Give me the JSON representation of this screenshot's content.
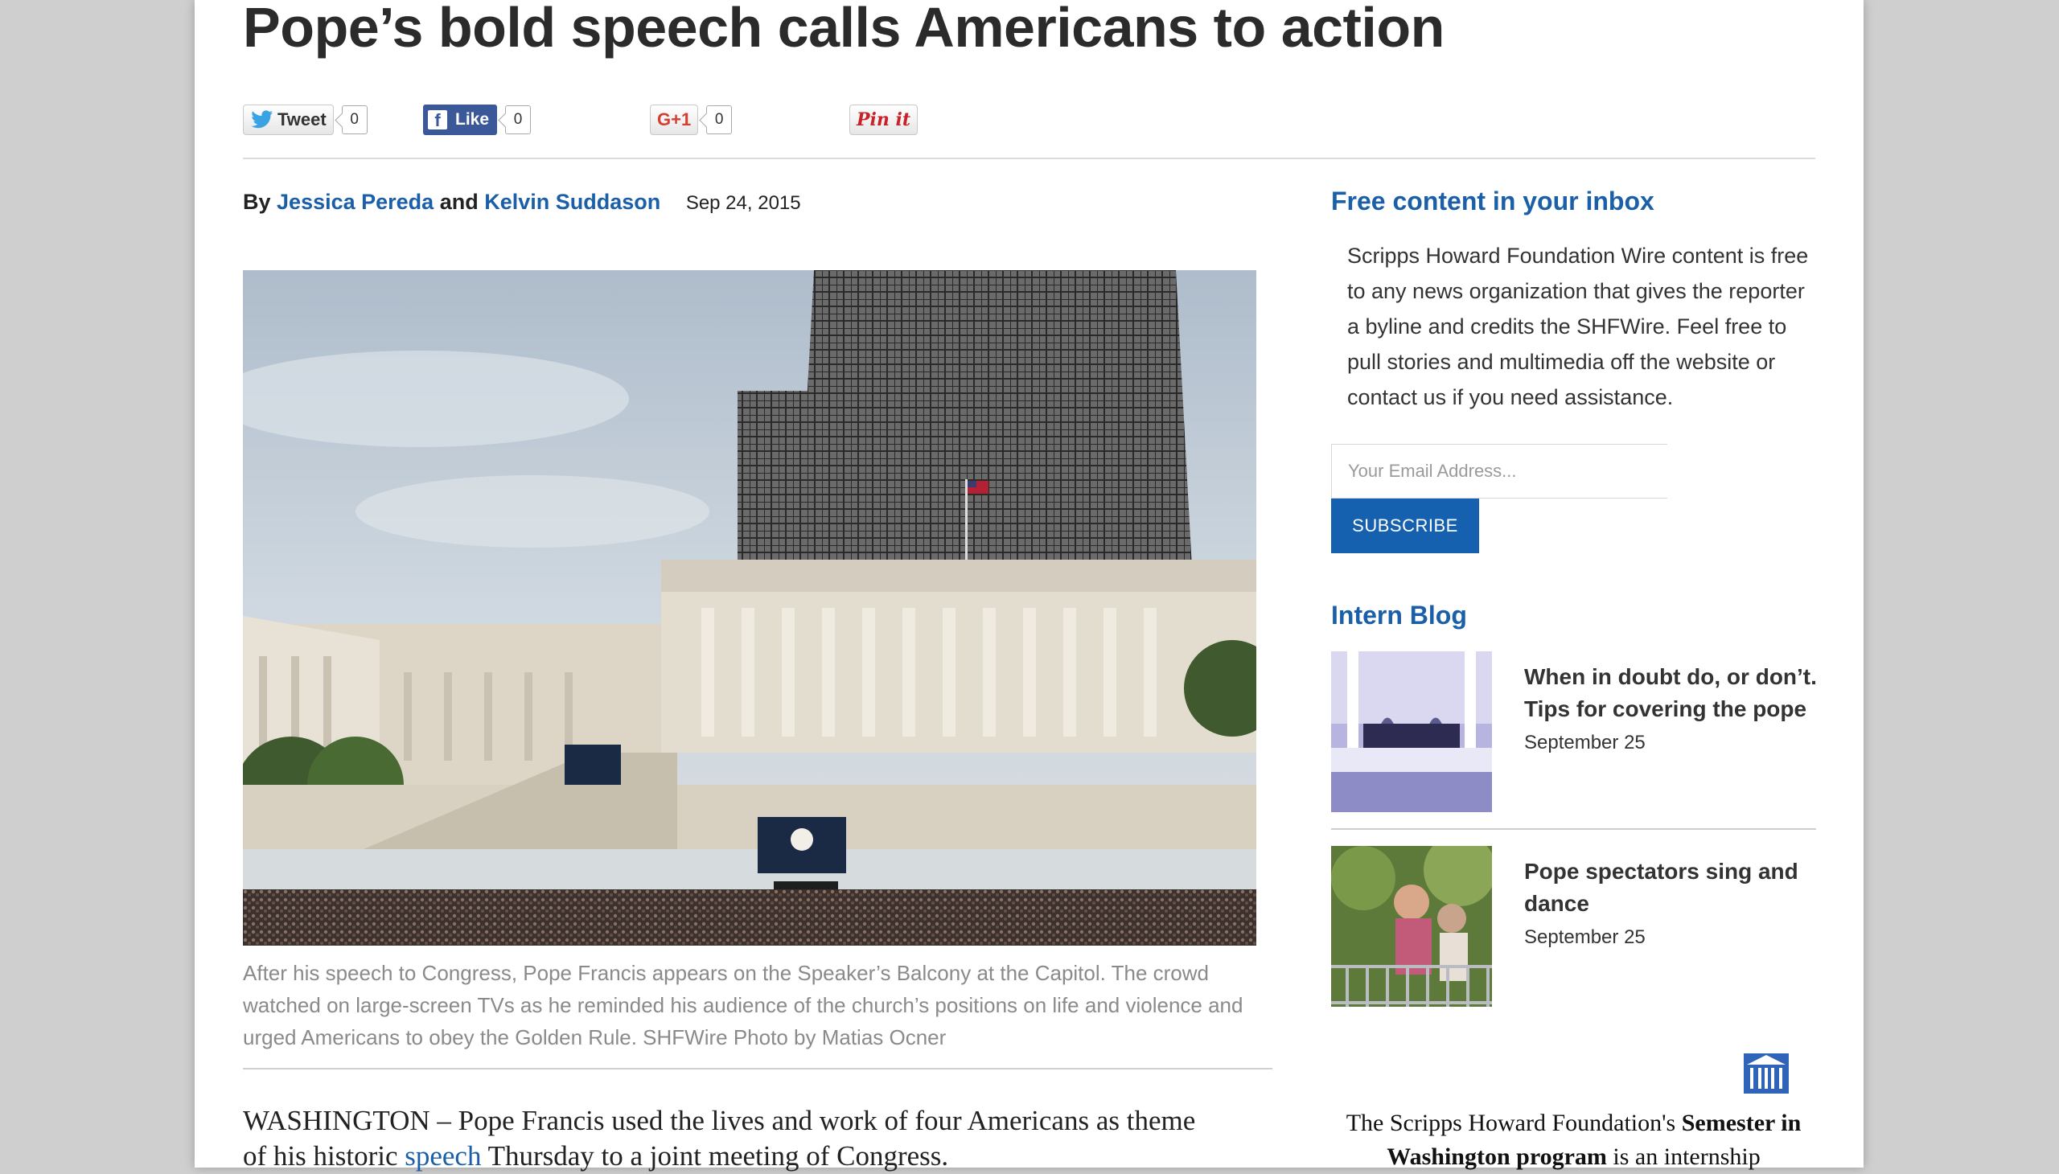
{
  "article": {
    "title": "Pope’s bold speech calls Americans to action",
    "byline_prefix": "By",
    "author1": "Jessica Pereda",
    "byline_and": "and",
    "author2": "Kelvin Suddason",
    "date": "Sep 24, 2015",
    "caption": "After his speech to Congress, Pope Francis appears on the Speaker’s Balcony at the Capitol. The crowd watched on large-screen TVs as he reminded his audience of the church’s positions on life and violence and urged Americans to obey the Golden Rule. SHFWire Photo by Matias Ocner",
    "body_line1": "WASHINGTON – Pope Francis used the lives and work of four Americans as theme",
    "body_line2_pre": "of his historic",
    "body_link": "speech",
    "body_line2_post": "Thursday to a joint meeting of Congress."
  },
  "share": {
    "tweet_label": "Tweet",
    "tweet_count": "0",
    "like_label": "Like",
    "like_count": "0",
    "gplus_label": "G+1",
    "gplus_count": "0",
    "pin_label": "Pin it"
  },
  "sidebar": {
    "inbox_title": "Free content in your inbox",
    "inbox_text": "Scripps Howard Foundation Wire content is free to any news organization that gives the reporter a byline and credits the SHFWire. Feel free to pull stories and multimedia off the website or contact us if you need assistance.",
    "email_placeholder": "Your Email Address...",
    "subscribe_label": "SUBSCRIBE",
    "blog_title": "Intern Blog",
    "posts": [
      {
        "title": "When in doubt do, or don’t. Tips for covering the pope",
        "date": "September 25"
      },
      {
        "title": "Pope spectators sing and dance",
        "date": "September 25"
      }
    ],
    "promo_pre": "The Scripps Howard Foundation's",
    "promo_bold": "Semester in Washington program",
    "promo_post": "is an internship"
  },
  "colors": {
    "link_blue": "#1a5fa8",
    "subscribe_bg": "#1660b0",
    "facebook": "#3b5998"
  }
}
